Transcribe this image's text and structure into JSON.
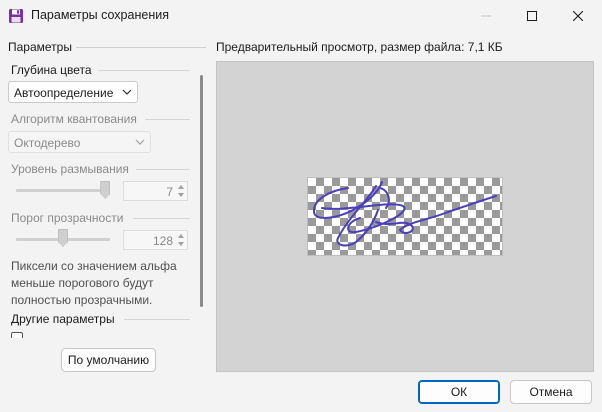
{
  "window": {
    "title": "Параметры сохранения",
    "icon": "floppy-disk-icon"
  },
  "left": {
    "header": "Параметры",
    "color_depth": {
      "label": "Глубина цвета",
      "value": "Автоопределение"
    },
    "quantization": {
      "label": "Алгоритм квантования",
      "value": "Октодерево",
      "disabled": true
    },
    "blur": {
      "label": "Уровень размывания",
      "value": "7",
      "slider_fraction": 0.95,
      "disabled": true
    },
    "transparency": {
      "label": "Порог прозрачности",
      "value": "128",
      "slider_fraction": 0.5,
      "disabled": true
    },
    "note": "Пиксели со значением альфа меньше порогового будут полностью прозрачными.",
    "other": {
      "label": "Другие параметры"
    },
    "default_button": "По умолчанию"
  },
  "right": {
    "header": "Предварительный просмотр, размер файла: 7,1 КБ"
  },
  "buttons": {
    "ok": "ОК",
    "cancel": "Отмена"
  },
  "colors": {
    "signature": "#4a3fbf",
    "accent": "#0067c0"
  }
}
